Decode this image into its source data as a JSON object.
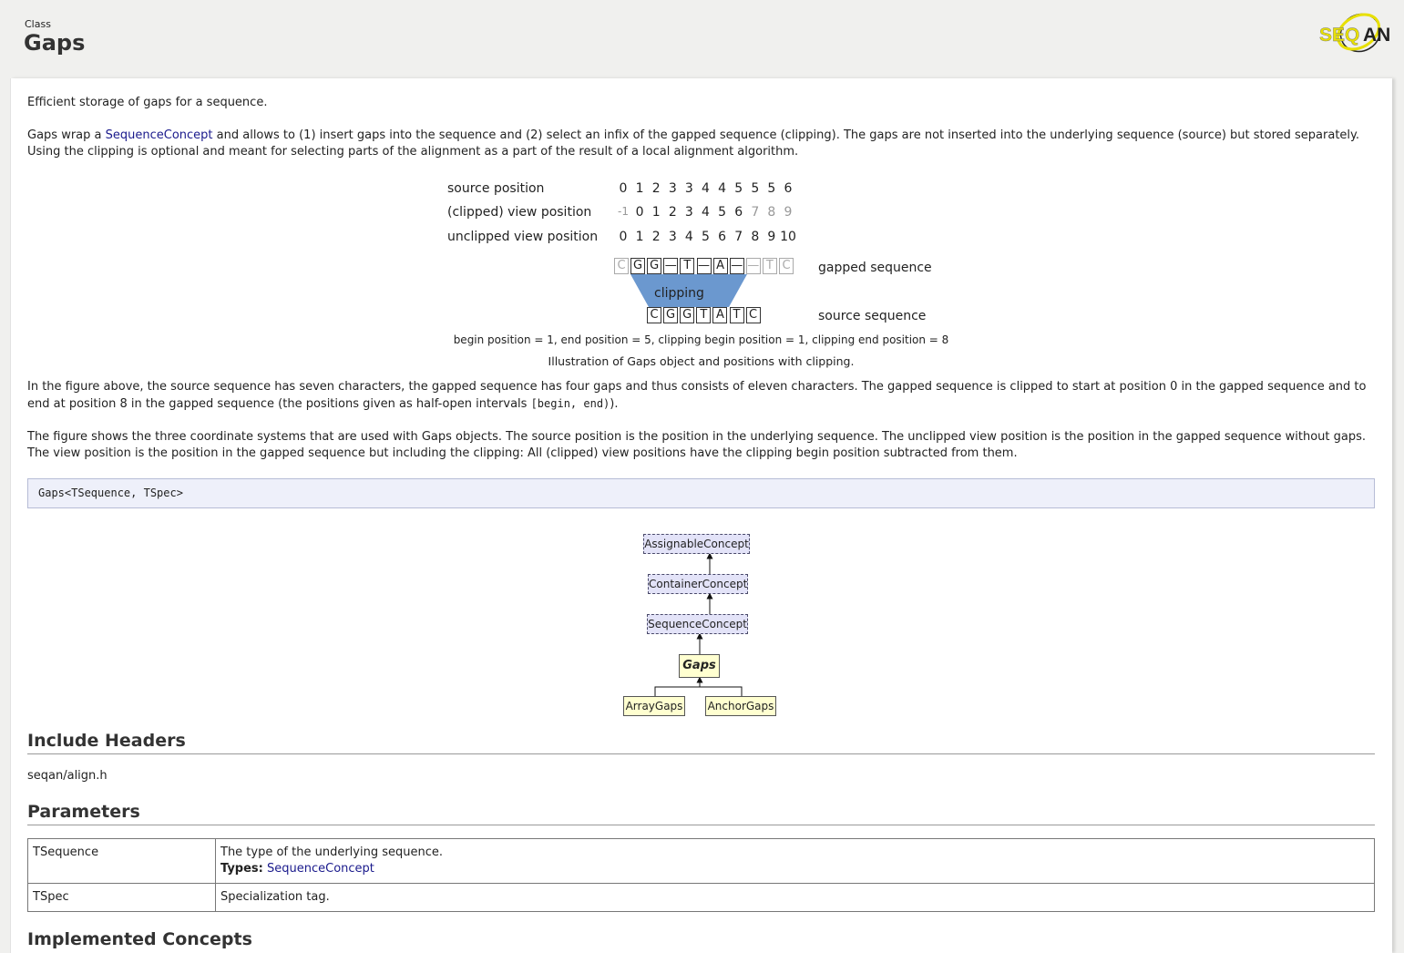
{
  "header": {
    "kind": "Class",
    "title": "Gaps",
    "logo_text": "SEQAN",
    "logo_colors": {
      "yellow": "#e8e000",
      "dark": "#222222"
    }
  },
  "intro": {
    "summary": "Efficient storage of gaps for a sequence.",
    "desc_prefix": "Gaps wrap a ",
    "desc_link": "SequenceConcept",
    "desc_suffix": " and allows to (1) insert gaps into the sequence and (2) select an infix of the gapped sequence (clipping). The gaps are not inserted into the underlying sequence (source) but stored separately. Using the clipping is optional and meant for selecting parts of the alignment as a part of the result of a local alignment algorithm."
  },
  "figure": {
    "rows": [
      {
        "label": "source position",
        "values": [
          "0",
          "1",
          "2",
          "3",
          "3",
          "4",
          "4",
          "5",
          "5",
          "5",
          "6"
        ],
        "dim": []
      },
      {
        "label": "(clipped) view position",
        "values": [
          "-1",
          "0",
          "1",
          "2",
          "3",
          "4",
          "5",
          "6",
          "7",
          "8",
          "9"
        ],
        "dim": [
          0,
          8,
          9,
          10
        ]
      },
      {
        "label": "unclipped view position",
        "values": [
          "0",
          "1",
          "2",
          "3",
          "4",
          "5",
          "6",
          "7",
          "8",
          "9",
          "10"
        ],
        "dim": []
      }
    ],
    "gapped_cells": [
      "C",
      "G",
      "G",
      "—",
      "T",
      "—",
      "A",
      "—",
      "—",
      "T",
      "C"
    ],
    "gapped_dim": [
      0,
      8,
      9,
      10
    ],
    "gapped_label": "gapped sequence",
    "clipping_label": "clipping",
    "clip_color": "#6b98cf",
    "source_cells": [
      "C",
      "G",
      "G",
      "T",
      "A",
      "T",
      "C"
    ],
    "source_label": "source sequence",
    "positions": "begin position = 1, end position = 5, clipping begin position = 1, clipping end position = 8",
    "caption": "Illustration of Gaps object and positions with clipping."
  },
  "body": {
    "p1_prefix": "In the figure above, the source sequence has seven characters, the gapped sequence has four gaps and thus consists of eleven characters. The gapped sequence is clipped to start at position 0 in the gapped sequence and to end at position 8 in the gapped sequence (the positions given as half-open intervals ",
    "p1_code": "[begin, end)",
    "p1_suffix": ").",
    "p2": "The figure shows the three coordinate systems that are used with Gaps objects. The source position is the position in the underlying sequence. The unclipped view position is the position in the gapped sequence without gaps. The view position is the position in the gapped sequence but including the clipping: All (clipped) view positions have the clipping begin position subtracted from them."
  },
  "signature": "Gaps<TSequence, TSpec>",
  "diagram": {
    "assignable": "AssignableConcept",
    "container": "ContainerConcept",
    "sequence": "SequenceConcept",
    "current": "Gaps",
    "child1": "ArrayGaps",
    "child2": "AnchorGaps"
  },
  "include": {
    "heading": "Include Headers",
    "path": "seqan/align.h"
  },
  "parameters": {
    "heading": "Parameters",
    "rows": [
      {
        "name": "TSequence",
        "desc": "The type of the underlying sequence.",
        "types_label": "Types:",
        "types_link": "SequenceConcept"
      },
      {
        "name": "TSpec",
        "desc": "Specialization tag."
      }
    ]
  },
  "implemented": {
    "heading": "Implemented Concepts"
  }
}
